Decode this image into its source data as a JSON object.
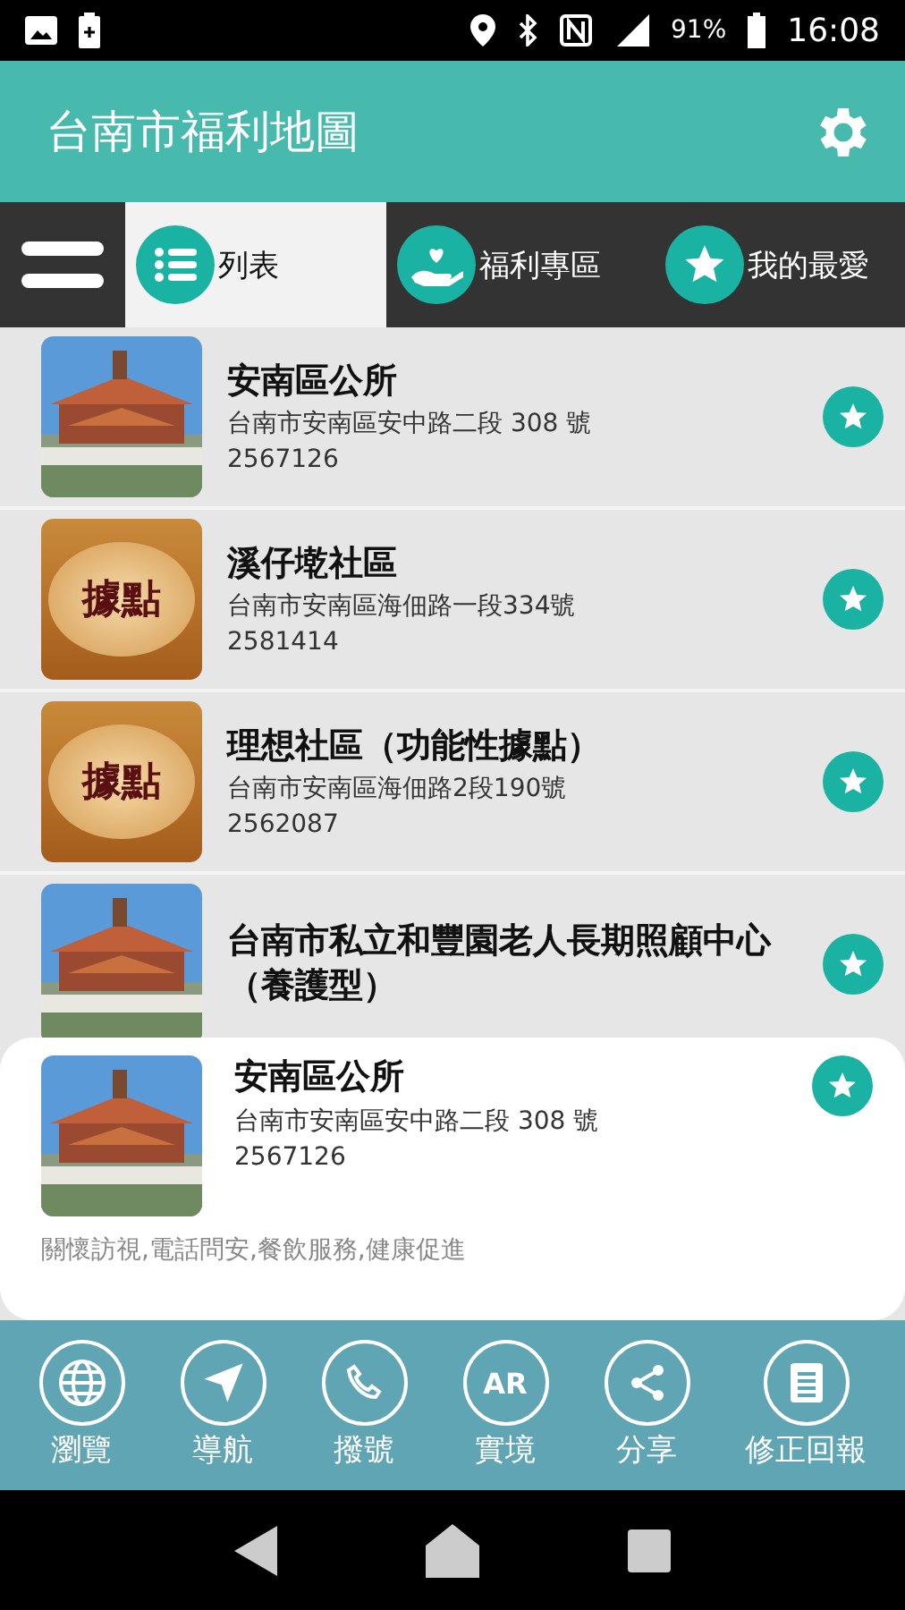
{
  "status_bar": {
    "battery": "91%",
    "time": "16:08"
  },
  "app_bar": {
    "title": "台南市福利地圖"
  },
  "tabs": [
    {
      "label": "列表",
      "kind": "list",
      "selected": true
    },
    {
      "label": "福利專區",
      "kind": "care",
      "selected": false
    },
    {
      "label": "我的最愛",
      "kind": "star",
      "selected": false
    }
  ],
  "places": [
    {
      "title": "安南區公所",
      "address": "台南市安南區安中路二段 308 號",
      "phone": "2567126"
    },
    {
      "title": "溪仔墘社區",
      "address": "台南市安南區海佃路一段334號",
      "phone": "2581414",
      "thumb": {
        "kind": "badge",
        "text": "據點"
      }
    },
    {
      "title": "理想社區（功能性據點）",
      "address": "台南市安南區海佃路2段190號",
      "phone": "2562087",
      "thumb": {
        "kind": "badge",
        "text": "據點"
      }
    },
    {
      "title": "台南市私立和豐園老人長期照顧中心（養護型）"
    }
  ],
  "detail_card": {
    "title": "安南區公所",
    "address": "台南市安南區安中路二段 308 號",
    "phone": "2567126",
    "services": "關懷訪視,電話問安,餐飲服務,健康促進"
  },
  "actions": [
    {
      "label": "瀏覽",
      "kind": "globe"
    },
    {
      "label": "導航",
      "kind": "navigate"
    },
    {
      "label": "撥號",
      "kind": "phone"
    },
    {
      "label": "實境",
      "kind": "ar",
      "icon_text": "AR"
    },
    {
      "label": "分享",
      "kind": "share"
    },
    {
      "label": "修正回報",
      "kind": "report"
    }
  ]
}
